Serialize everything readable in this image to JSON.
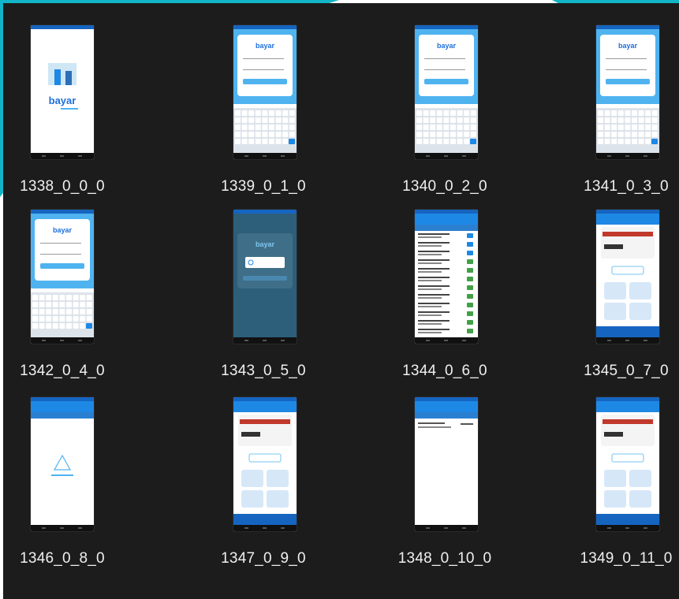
{
  "files": [
    {
      "name": "1338_0_0_0",
      "variant": "splash"
    },
    {
      "name": "1339_0_1_0",
      "variant": "login-kbd"
    },
    {
      "name": "1340_0_2_0",
      "variant": "login-kbd"
    },
    {
      "name": "1341_0_3_0",
      "variant": "login-kbd"
    },
    {
      "name": "1342_0_4_0",
      "variant": "login-kbd"
    },
    {
      "name": "1343_0_5_0",
      "variant": "login-loading"
    },
    {
      "name": "1344_0_6_0",
      "variant": "list"
    },
    {
      "name": "1345_0_7_0",
      "variant": "home"
    },
    {
      "name": "1346_0_8_0",
      "variant": "empty"
    },
    {
      "name": "1347_0_9_0",
      "variant": "home"
    },
    {
      "name": "1348_0_10_0",
      "variant": "billing"
    },
    {
      "name": "1349_0_11_0",
      "variant": "home"
    }
  ],
  "colors": {
    "explorer_bg": "#1c1c1c",
    "brand_blue": "#1e88e5",
    "light_blue": "#4fb3f0",
    "teal_decor": "#12b5c7"
  }
}
